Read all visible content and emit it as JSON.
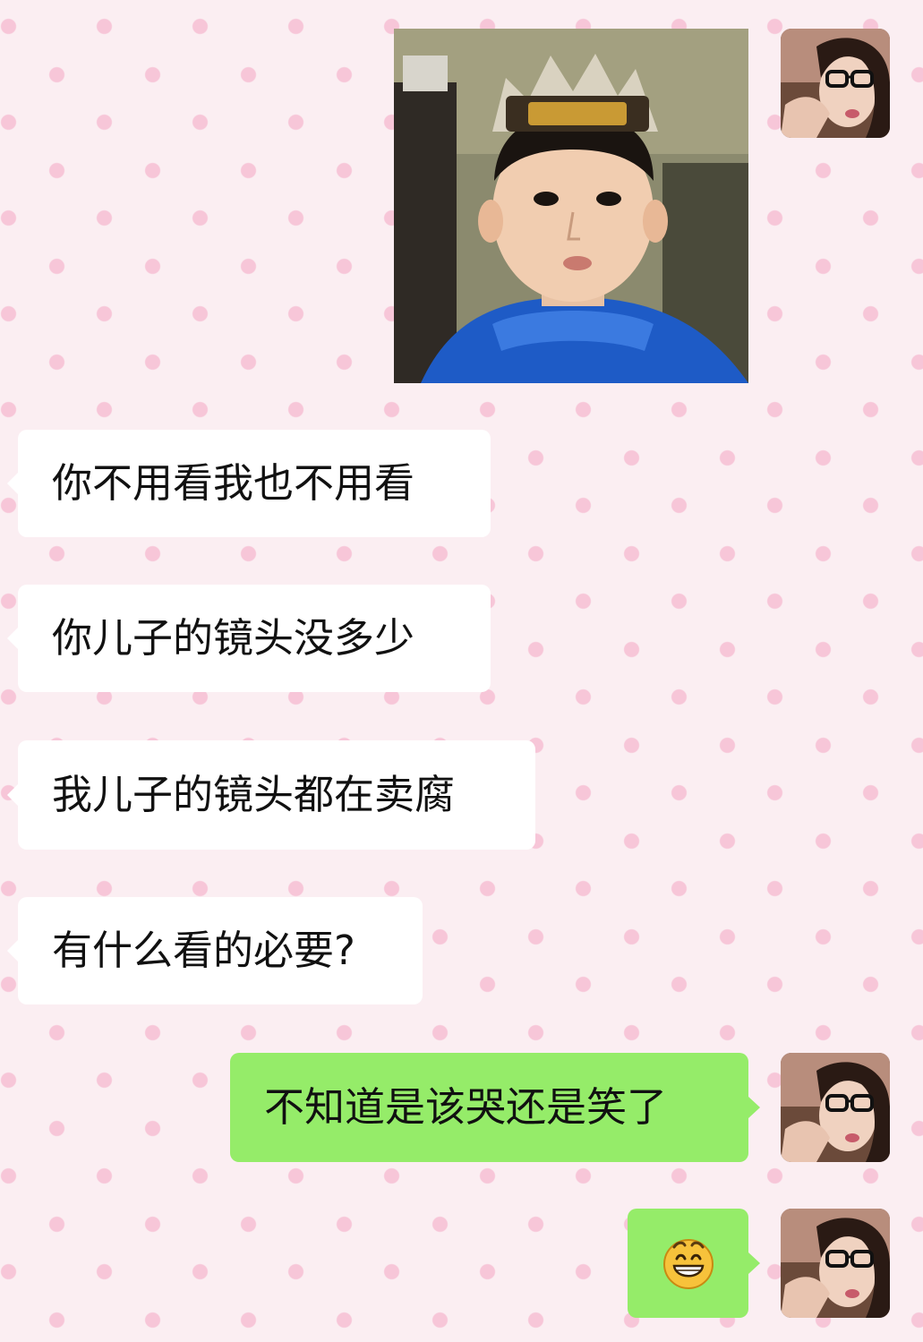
{
  "chat": {
    "messages": [
      {
        "type": "image",
        "direction": "outgoing",
        "content": "photo of a boy wearing a crown hat and blue hoodie"
      },
      {
        "type": "text",
        "direction": "incoming",
        "text": "你不用看我也不用看"
      },
      {
        "type": "text",
        "direction": "incoming",
        "text": "你儿子的镜头没多少"
      },
      {
        "type": "text",
        "direction": "incoming",
        "text": "我儿子的镜头都在卖腐"
      },
      {
        "type": "text",
        "direction": "incoming",
        "text": "有什么看的必要?"
      },
      {
        "type": "text",
        "direction": "outgoing",
        "text": "不知道是该哭还是笑了"
      },
      {
        "type": "emoji",
        "direction": "outgoing",
        "icon": "grinning-face-emoji"
      }
    ]
  },
  "colors": {
    "background": "#fbeef2",
    "dot": "#f7c6d8",
    "incoming_bubble": "#ffffff",
    "outgoing_bubble": "#95ec69"
  }
}
